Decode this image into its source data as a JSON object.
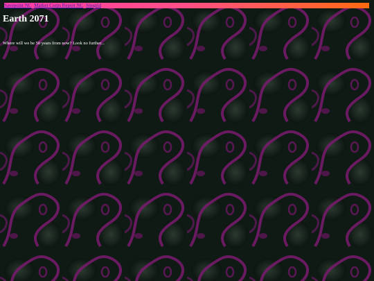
{
  "nav": {
    "links": [
      {
        "label": "Savepoint NC"
      },
      {
        "label": "Market Corps Report NC"
      },
      {
        "label": "Sitegrid"
      }
    ]
  },
  "page": {
    "title": "Earth 2071",
    "tagline": "Where will we be 50 years from now? Look no further..."
  },
  "colors": {
    "background": "#0f1a14",
    "pattern_accent": "#7a1a6e",
    "nav_gradient_start": "#ff3fa8",
    "nav_gradient_end": "#ff6a10",
    "link": "#3a1bb0",
    "text": "#ffffff"
  }
}
